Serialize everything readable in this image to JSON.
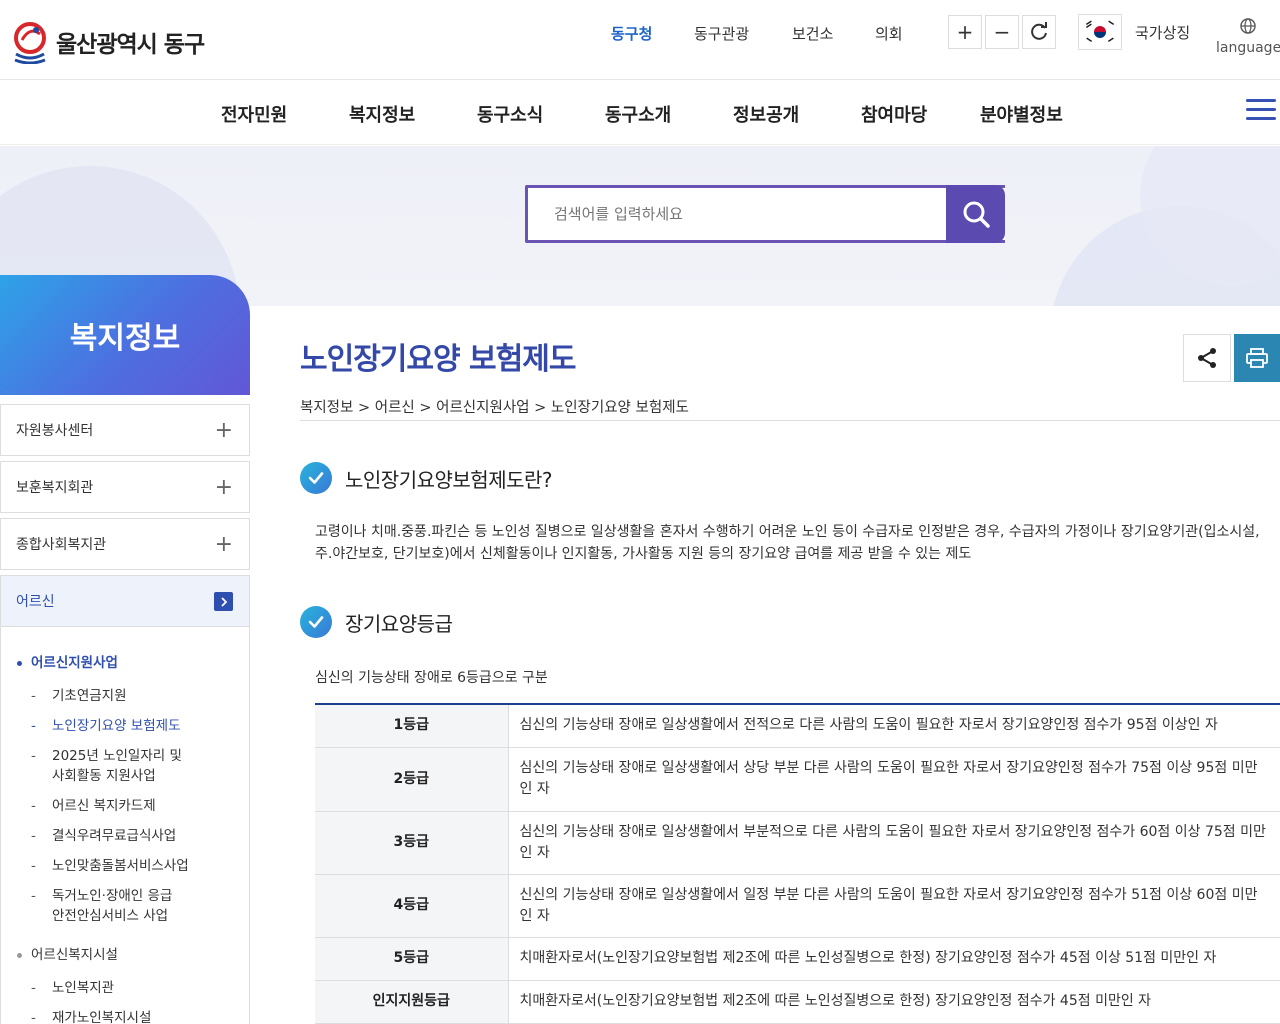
{
  "header": {
    "logo_text": "울산광역시 동구",
    "site_links": [
      "동구청",
      "동구관광",
      "보건소",
      "의회"
    ],
    "active_site": "동구청",
    "zoom_in": "+",
    "zoom_out": "−",
    "national_symbol": "국가상징",
    "language": "language"
  },
  "gnb": {
    "items": [
      "전자민원",
      "복지정보",
      "동구소식",
      "동구소개",
      "정보공개",
      "참여마당",
      "분야별정보"
    ]
  },
  "search": {
    "placeholder": "검색어를 입력하세요"
  },
  "sidebar": {
    "title": "복지정보",
    "items": [
      {
        "label": "자원봉사센터"
      },
      {
        "label": "보훈복지회관"
      },
      {
        "label": "종합사회복지관"
      },
      {
        "label": "어르신"
      }
    ],
    "sub": {
      "group1": "어르신지원사업",
      "group1_items": [
        "기초연금지원",
        "노인장기요양 보험제도",
        "2025년 노인일자리 및 사회활동 지원사업",
        "어르신 복지카드제",
        "결식우려무료급식사업",
        "노인맞춤돌봄서비스사업",
        "독거노인·장애인 응급안전안심서비스 사업"
      ],
      "group2": "어르신복지시설",
      "group2_items": [
        "노인복지관",
        "재가노인복지시설"
      ]
    }
  },
  "content": {
    "title": "노인장기요양 보험제도",
    "breadcrumb": "복지정보 > 어르신 > 어르신지원사업 > 노인장기요양 보험제도",
    "section1_title": "노인장기요양보험제도란?",
    "section1_body": "고령이나 치매.중풍.파킨슨 등 노인성 질병으로 일상생활을 혼자서 수행하기 어려운 노인 등이 수급자로 인정받은 경우, 수급자의 가정이나 장기요양기관(입소시설, 주.야간보호, 단기보호)에서 신체활동이나 인지활동, 가사활동 지원 등의 장기요양 급여를 제공 받을 수 있는 제도",
    "section2_title": "장기요양등급",
    "section2_sub": "심신의 기능상태 장애로 6등급으로 구분",
    "grades": [
      {
        "grade": "1등급",
        "desc": "심신의 기능상태 장애로 일상생활에서 전적으로 다른 사람의 도움이 필요한 자로서 장기요양인정 점수가 95점 이상인 자"
      },
      {
        "grade": "2등급",
        "desc": "심신의 기능상태 장애로 일상생활에서 상당 부분 다른 사람의 도움이 필요한 자로서 장기요양인정 점수가 75점 이상 95점 미만인 자"
      },
      {
        "grade": "3등급",
        "desc": "심신의 기능상태 장애로 일상생활에서 부분적으로 다른 사람의 도움이 필요한 자로서 장기요양인정 점수가 60점 이상 75점 미만인 자"
      },
      {
        "grade": "4등급",
        "desc": "신신의 기능상태 장애로 일상생활에서 일정 부분 다른 사람의 도움이 필요한 자로서 장기요양인정 점수가 51점 이상 60점 미만인 자"
      },
      {
        "grade": "5등급",
        "desc": "치매환자로서(노인장기요양보험법 제2조에 따른 노인성질병으로 한정) 장기요양인정 점수가 45점 이상 51점 미만인 자"
      },
      {
        "grade": "인지지원등급",
        "desc": "치매환자로서(노인장기요양보험법 제2조에 따른 노인성질병으로 한정) 장기요양인정 점수가 45점 미만인 자"
      }
    ]
  },
  "colors": {
    "accent": "#3348a8",
    "search_border": "#6b55b4",
    "print_button": "#2c86b2"
  }
}
